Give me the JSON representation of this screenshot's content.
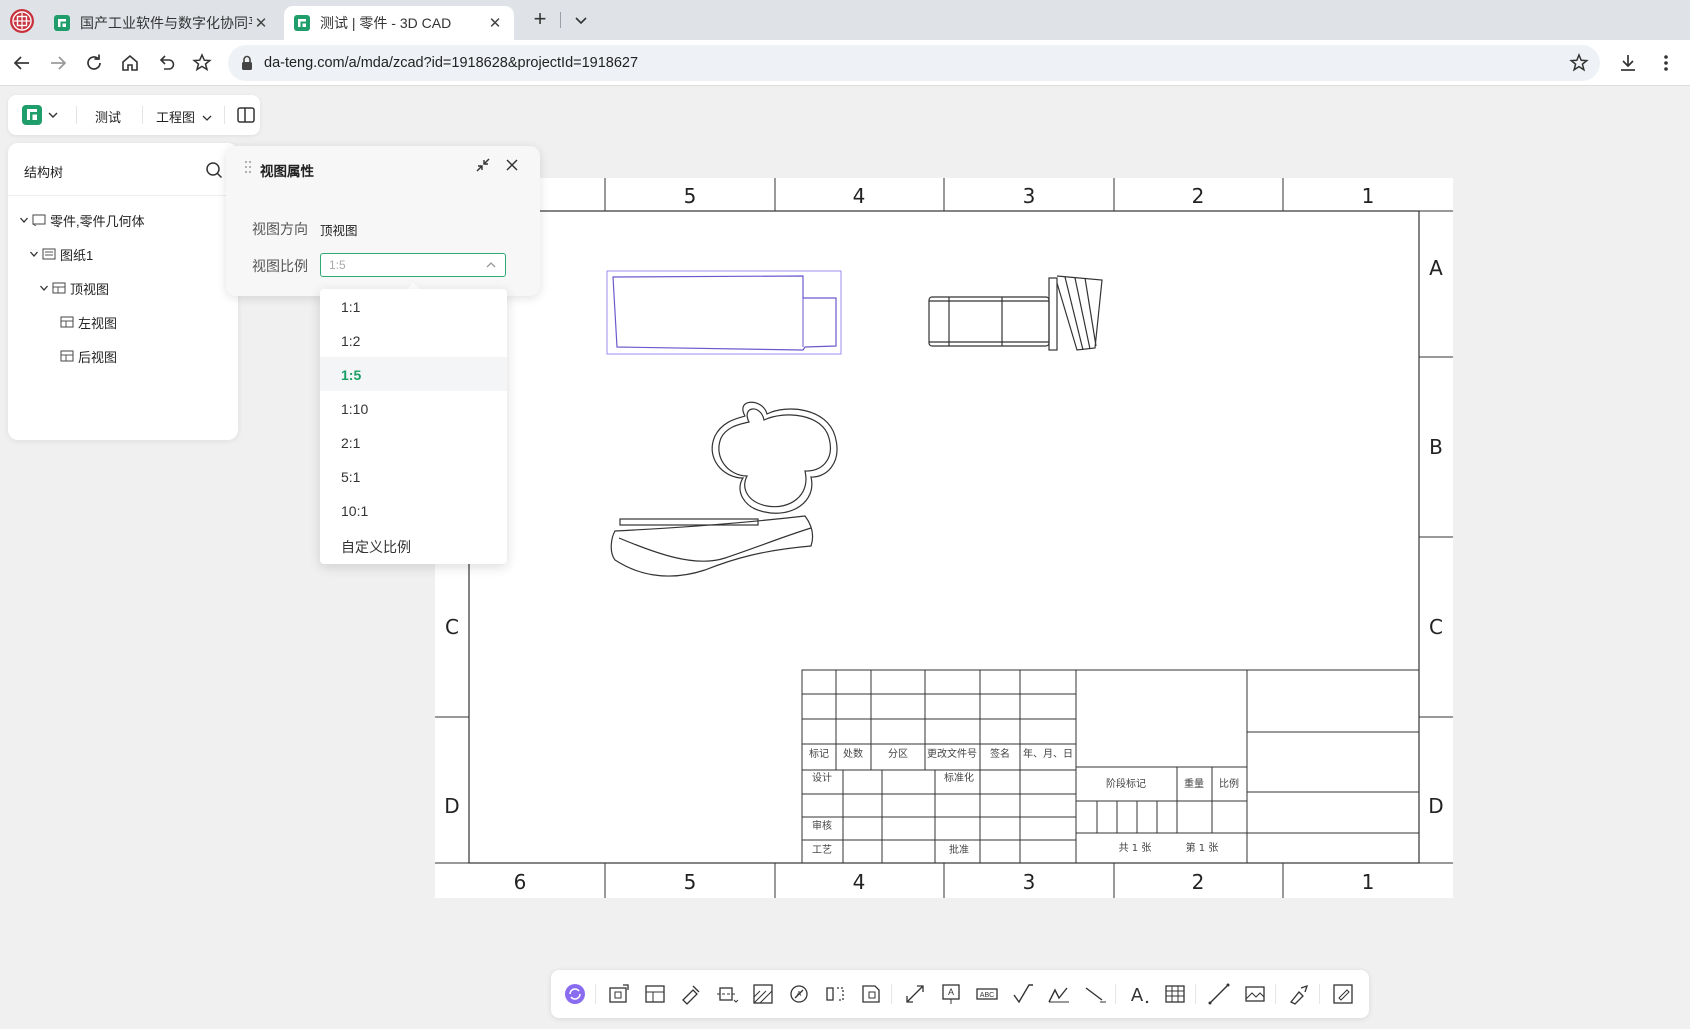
{
  "browser": {
    "tabs": [
      {
        "title": "国产工业软件与数字化协同平",
        "icon": "cad-app-icon",
        "active": false
      },
      {
        "title": "测试 | 零件 - 3D CAD",
        "icon": "cad-app-icon",
        "active": true
      }
    ],
    "url": "da-teng.com/a/mda/zcad?id=1918628&projectId=1918627"
  },
  "app_toolbar": {
    "project_name": "测试",
    "mode_label": "工程图"
  },
  "tree": {
    "title": "结构树",
    "nodes": [
      {
        "label": "零件,零件几何体",
        "icon": "part-icon"
      },
      {
        "label": "图纸1",
        "icon": "sheet-icon"
      },
      {
        "label": "顶视图",
        "icon": "view-icon"
      },
      {
        "label": "左视图",
        "icon": "view-icon"
      },
      {
        "label": "后视图",
        "icon": "view-icon"
      }
    ]
  },
  "view_props": {
    "title": "视图属性",
    "direction_label": "视图方向",
    "direction_value": "顶视图",
    "scale_label": "视图比例",
    "scale_value": "1:5",
    "scale_options": [
      "1:1",
      "1:2",
      "1:5",
      "1:10",
      "2:1",
      "5:1",
      "10:1",
      "自定义比例"
    ],
    "selected_scale": "1:5"
  },
  "drawing": {
    "col_labels_top": [
      "5",
      "4",
      "3",
      "2",
      "1"
    ],
    "col_labels_bottom": [
      "6",
      "5",
      "4",
      "3",
      "2",
      "1"
    ],
    "row_labels_left": [
      "C",
      "D"
    ],
    "row_labels_right": [
      "A",
      "B",
      "C",
      "D"
    ],
    "title_block": {
      "mark": "标记",
      "count": "处数",
      "zone": "分区",
      "change_doc": "更改文件号",
      "signature": "签名",
      "date": "年、月、日",
      "design": "设计",
      "standardize": "标准化",
      "review": "审核",
      "process": "工艺",
      "approve": "批准",
      "stage_mark": "阶段标记",
      "weight": "重量",
      "scale": "比例",
      "sheets_total": "共 1 张",
      "sheet_no": "第 1 张"
    }
  },
  "colors": {
    "accent": "#2eaa76",
    "selection": "#7b68ee",
    "line": "#333333"
  },
  "bottom_tools": [
    "sync-icon",
    "base-view-icon",
    "projected-view-icon",
    "auxiliary-view-icon",
    "section-view-icon",
    "detail-view-icon",
    "break-view-icon",
    "crop-view-icon",
    "broken-out-icon",
    "align-view-icon",
    "dimension-icon",
    "balloon-icon",
    "datum-icon",
    "surface-finish-icon",
    "weld-symbol-icon",
    "leader-icon",
    "text-icon",
    "table-icon",
    "line-icon",
    "image-icon",
    "format-painter-icon",
    "edit-sheet-icon"
  ]
}
